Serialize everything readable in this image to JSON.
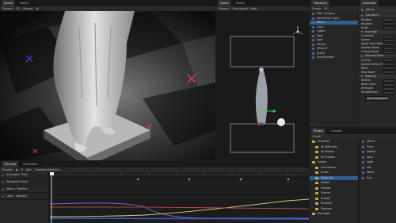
{
  "scene_view": {
    "tabs": [
      "Scene",
      "Game"
    ],
    "toolbar": [
      "Shaded",
      "2D",
      "Gizmos",
      "All"
    ],
    "perspective_label": "Persp"
  },
  "game_view": {
    "tabs": [
      "Game",
      "Scene"
    ],
    "toolbar": [
      "Display 1",
      "Free Aspect",
      "Scale",
      "Maximize On Play",
      "Mute Audio",
      "Stats",
      "Gizmos"
    ]
  },
  "hierarchy": {
    "tab": "Hierarchy",
    "create_label": "Create",
    "search_placeholder": "All",
    "items": [
      {
        "label": "Main Camera",
        "selected": false
      },
      {
        "label": "Directional Light",
        "selected": false
      },
      {
        "label": "Venus",
        "selected": true
      },
      {
        "label": "Floor",
        "selected": false
      },
      {
        "label": "Lights",
        "selected": false
      },
      {
        "label": "Spot",
        "selected": false
      },
      {
        "label": "Spot",
        "selected": false
      },
      {
        "label": "Effects",
        "selected": false
      },
      {
        "label": "Effect B",
        "selected": false
      },
      {
        "label": "Audio",
        "selected": false
      },
      {
        "label": "EventSystem",
        "selected": false
      }
    ]
  },
  "inspector": {
    "tab": "Inspector",
    "object_name": "Venus",
    "sections": [
      {
        "title": "Transform",
        "rows": [
          "Position",
          "Rotation",
          "Scale"
        ]
      },
      {
        "title": "Animator",
        "rows": [
          "Controller",
          "Avatar",
          "Apply Root Motion",
          "Update Mode",
          "Culling Mode"
        ]
      },
      {
        "title": "Skinned Mesh",
        "rows": [
          "Quality",
          "Update When Offscreen",
          "Mesh",
          "Root Bone"
        ]
      },
      {
        "title": "Material",
        "rows": [
          "Shader",
          "Base Color",
          "Emission",
          "Smoothness"
        ]
      }
    ],
    "add_component": "Add Component"
  },
  "project": {
    "tabs": [
      "Project",
      "Console"
    ],
    "create_label": "Create",
    "tree": [
      "Favorites",
      "All Materials",
      "All Models",
      "All Prefabs",
      "Assets",
      "Animations",
      "Audio",
      "Materials",
      "Models",
      "Prefabs",
      "Scenes",
      "Scripts",
      "Shaders",
      "Textures",
      "Packages"
    ],
    "files": [
      "Venus",
      "Floor",
      "Marble",
      "Spot",
      "Light",
      "Idle",
      "Wave",
      "Turn"
    ]
  },
  "timeline": {
    "tabs": [
      "Timeline",
      "Animation"
    ],
    "toolbar": [
      "Preview",
      "Add",
      "Timeline (Director)"
    ],
    "tracks": [
      {
        "label": "Animation Track"
      },
      {
        "label": "Activation Track"
      },
      {
        "label": "Venus : Position"
      },
      {
        "label": "Light : Intensity"
      }
    ],
    "frame_label": "0"
  },
  "colors": {
    "accent": "#2e5d8f",
    "curve_purple": "#8a5cc9",
    "curve_blue": "#3b5fd0",
    "curve_yellow": "#e0cf70",
    "curve_red": "#c85050",
    "playhead": "#f0f0f0",
    "gizmo_green": "#39d04a"
  }
}
